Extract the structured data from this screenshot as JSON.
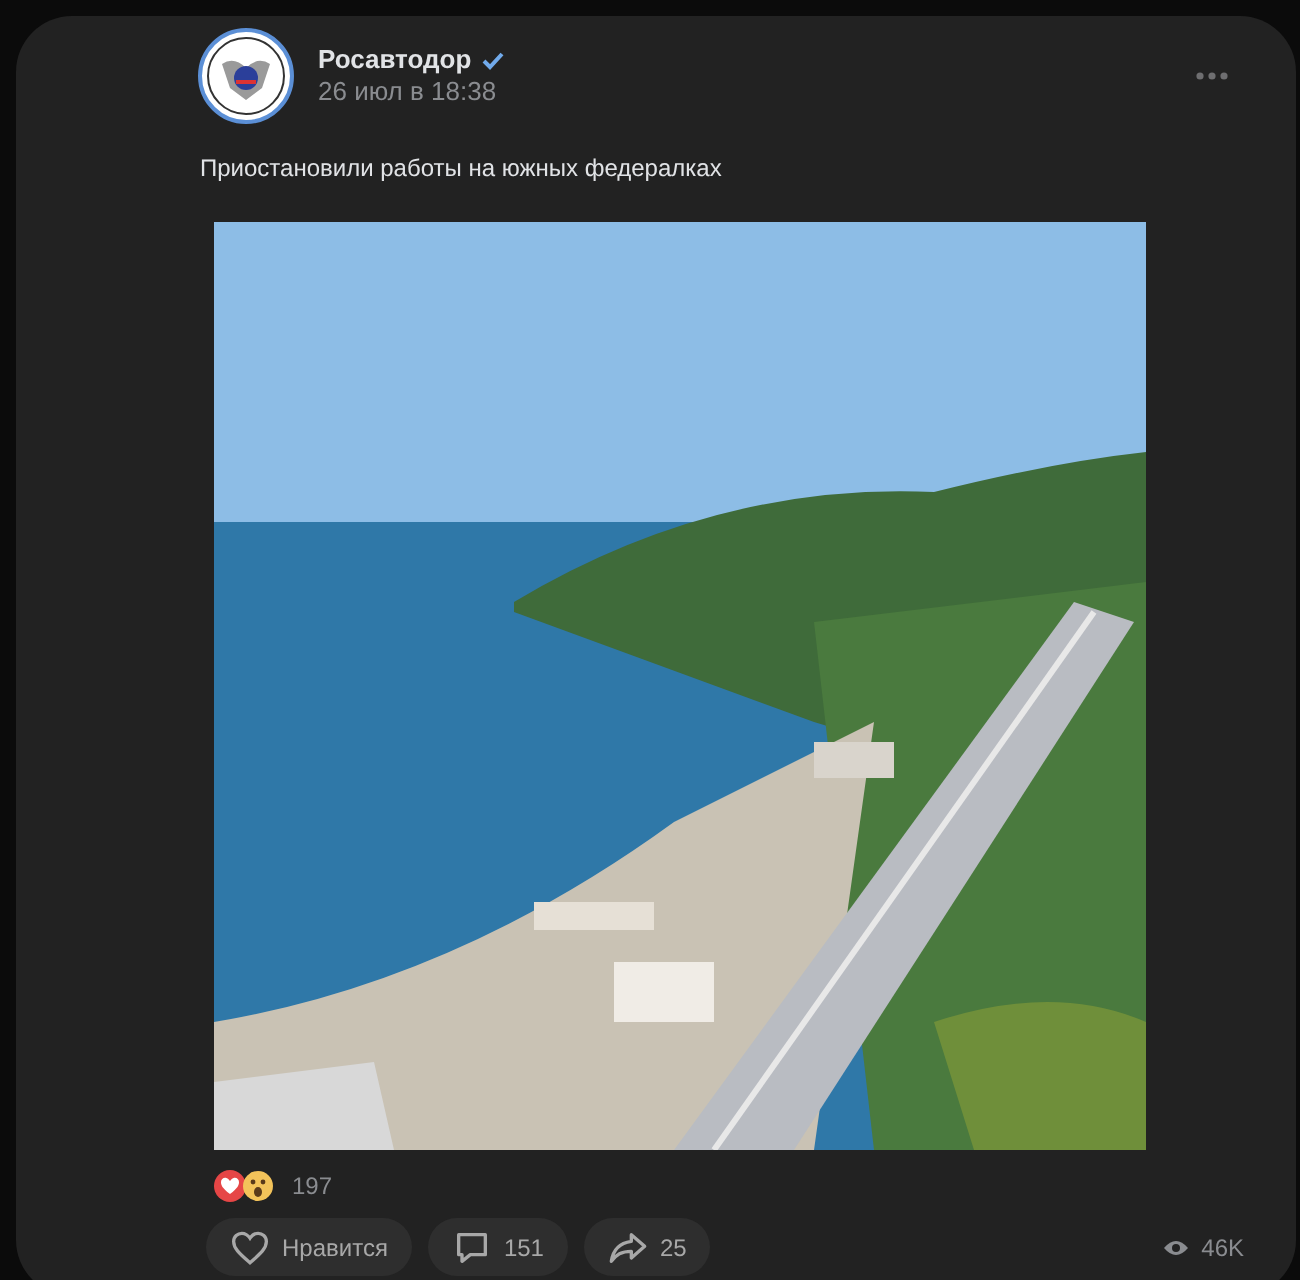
{
  "post": {
    "author": "Росавтодор",
    "verified": true,
    "time": "26 июл в 18:38",
    "text": "Приостановили работы на южных федералках",
    "reactions_count": "197",
    "actions": [
      {
        "kind": "like",
        "label": "Нравится",
        "liked": false
      },
      {
        "kind": "comment",
        "label": "151"
      },
      {
        "kind": "share",
        "label": "25"
      }
    ],
    "views": "46K"
  }
}
